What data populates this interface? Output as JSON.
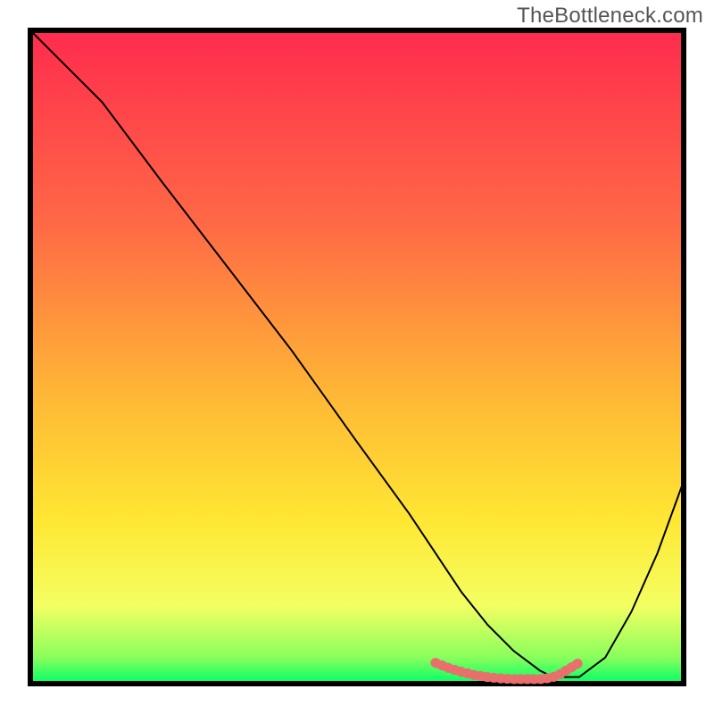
{
  "watermark": "TheBottleneck.com",
  "chart_data": {
    "type": "line",
    "title": "",
    "xlabel": "",
    "ylabel": "",
    "xlim": [
      0,
      100
    ],
    "ylim": [
      0,
      100
    ],
    "grid": false,
    "legend": false,
    "gradient_stops": [
      {
        "offset": 0,
        "color": "#ff2b4e"
      },
      {
        "offset": 30,
        "color": "#ff6a45"
      },
      {
        "offset": 55,
        "color": "#ffb536"
      },
      {
        "offset": 75,
        "color": "#ffe733"
      },
      {
        "offset": 88,
        "color": "#f4ff62"
      },
      {
        "offset": 96,
        "color": "#89ff5c"
      },
      {
        "offset": 100,
        "color": "#00ff66"
      }
    ],
    "series": [
      {
        "name": "curve",
        "color": "#000000",
        "width": 2,
        "x": [
          0,
          4,
          8,
          11,
          20,
          30,
          40,
          50,
          58,
          62,
          64,
          66,
          70,
          74,
          78,
          80,
          82,
          84,
          88,
          92,
          96,
          100
        ],
        "y": [
          100,
          96,
          92,
          89,
          77,
          64,
          51,
          37,
          26,
          20,
          17,
          14,
          9,
          5,
          2,
          1,
          1,
          1,
          4,
          11,
          20,
          31
        ]
      },
      {
        "name": "bottom-highlight",
        "color": "#e96f6d",
        "dash": [
          1,
          6.5
        ],
        "width": 11,
        "linecap": "round",
        "x": [
          62,
          64,
          66,
          68,
          70,
          72,
          74,
          76,
          78,
          79,
          80,
          81,
          82,
          83,
          84
        ],
        "y": [
          3.2,
          2.4,
          1.8,
          1.3,
          1.0,
          0.8,
          0.7,
          0.7,
          0.7,
          0.8,
          1.0,
          1.4,
          2.0,
          2.6,
          3.2
        ]
      }
    ]
  }
}
